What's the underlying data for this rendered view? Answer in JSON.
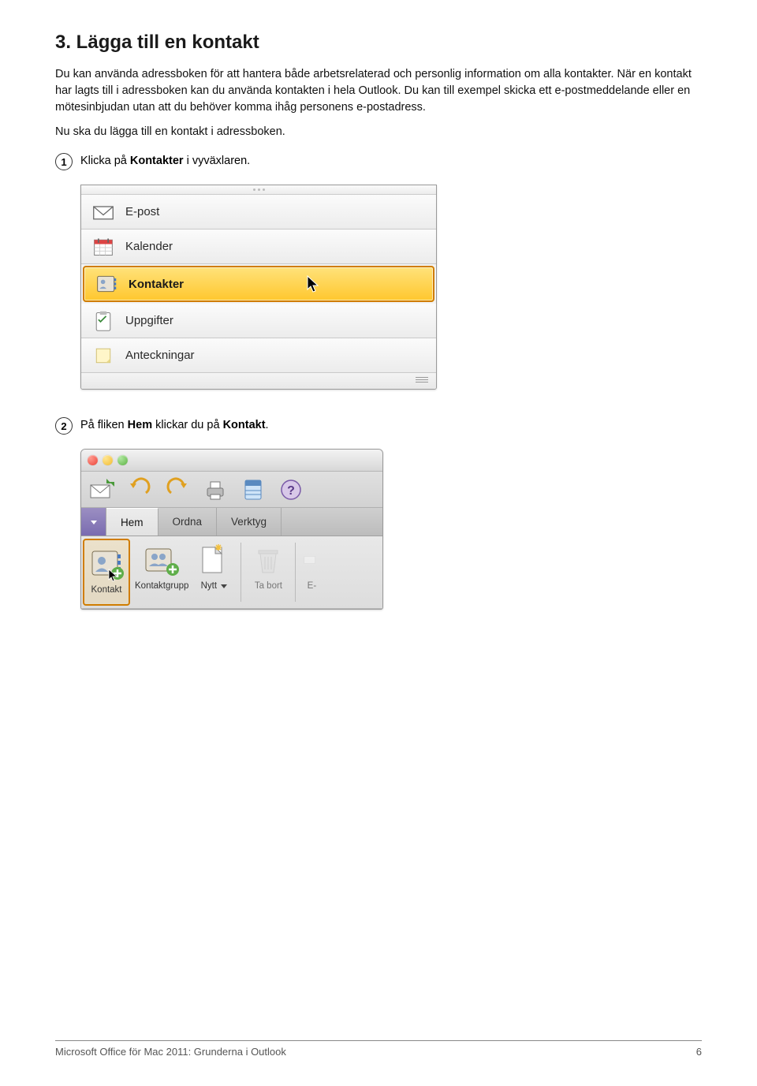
{
  "heading": "3. Lägga till en kontakt",
  "para1": "Du kan använda adressboken för att hantera både arbetsrelaterad och personlig information om alla kontakter. När en kontakt har lagts till i adressboken kan du använda kontakten i hela Outlook. Du kan till exempel skicka ett e-postmeddelande eller en mötesinbjudan utan att du behöver komma ihåg personens e-postadress.",
  "instruction": "Nu ska du lägga till en kontakt i adressboken.",
  "step1": {
    "num": "1",
    "pre": "Klicka på ",
    "bold": "Kontakter",
    "post": " i vyväxlaren."
  },
  "viewswitcher": {
    "items": [
      {
        "label": "E-post"
      },
      {
        "label": "Kalender"
      },
      {
        "label": "Kontakter"
      },
      {
        "label": "Uppgifter"
      },
      {
        "label": "Anteckningar"
      }
    ]
  },
  "step2": {
    "num": "2",
    "pre": "På fliken ",
    "bold1": "Hem",
    "mid": " klickar du på ",
    "bold2": "Kontakt",
    "post": "."
  },
  "ribbon": {
    "tabs": {
      "hem": "Hem",
      "ordna": "Ordna",
      "verktyg": "Verktyg"
    },
    "buttons": {
      "kontakt": "Kontakt",
      "kontaktgrupp": "Kontaktgrupp",
      "nytt": "Nytt",
      "tabort": "Ta bort",
      "efollow": "E-"
    }
  },
  "footer": {
    "left": "Microsoft Office för Mac 2011: Grunderna i Outlook",
    "right": "6"
  }
}
